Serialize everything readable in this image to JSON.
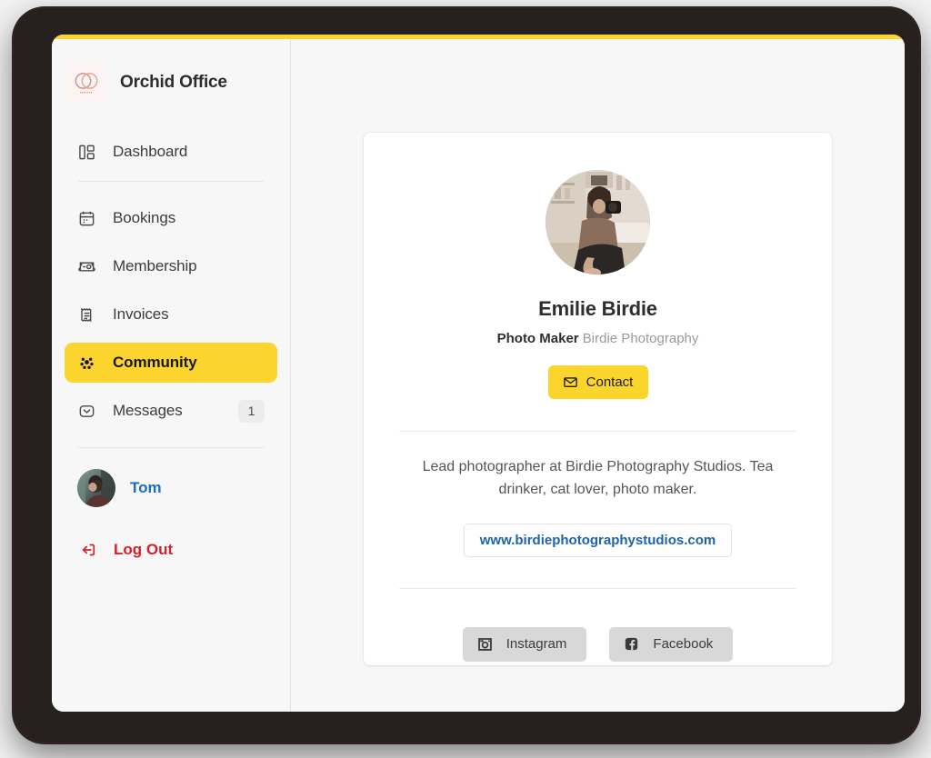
{
  "app": {
    "brand_name": "Orchid Office",
    "accent_color": "#fbd52e",
    "logo_icon": "overlapping-circles-logo"
  },
  "sidebar": {
    "items": [
      {
        "label": "Dashboard",
        "icon": "dashboard-icon",
        "active": false,
        "badge": null
      },
      {
        "label": "Bookings",
        "icon": "calendar-icon",
        "active": false,
        "badge": null
      },
      {
        "label": "Membership",
        "icon": "membership-card-icon",
        "active": false,
        "badge": null
      },
      {
        "label": "Invoices",
        "icon": "invoice-icon",
        "active": false,
        "badge": null
      },
      {
        "label": "Community",
        "icon": "community-dots-icon",
        "active": true,
        "badge": null
      },
      {
        "label": "Messages",
        "icon": "message-chevron-icon",
        "active": false,
        "badge": "1"
      }
    ],
    "user": {
      "name": "Tom",
      "avatar_icon": "user-avatar-photo",
      "name_color": "#1a6fc4"
    },
    "logout": {
      "label": "Log Out",
      "icon": "logout-icon",
      "color": "#d32029"
    }
  },
  "profile": {
    "avatar_icon": "profile-photo",
    "name": "Emilie Birdie",
    "role_title": "Photo Maker",
    "role_company": "Birdie Photography",
    "contact_button": {
      "label": "Contact",
      "icon": "mail-icon"
    },
    "bio": "Lead photographer at Birdie Photography Studios. Tea drinker, cat lover, photo maker.",
    "website": "www.birdiephotographystudios.com",
    "social": [
      {
        "label": "Instagram",
        "icon": "instagram-icon"
      },
      {
        "label": "Facebook",
        "icon": "facebook-icon"
      }
    ]
  }
}
